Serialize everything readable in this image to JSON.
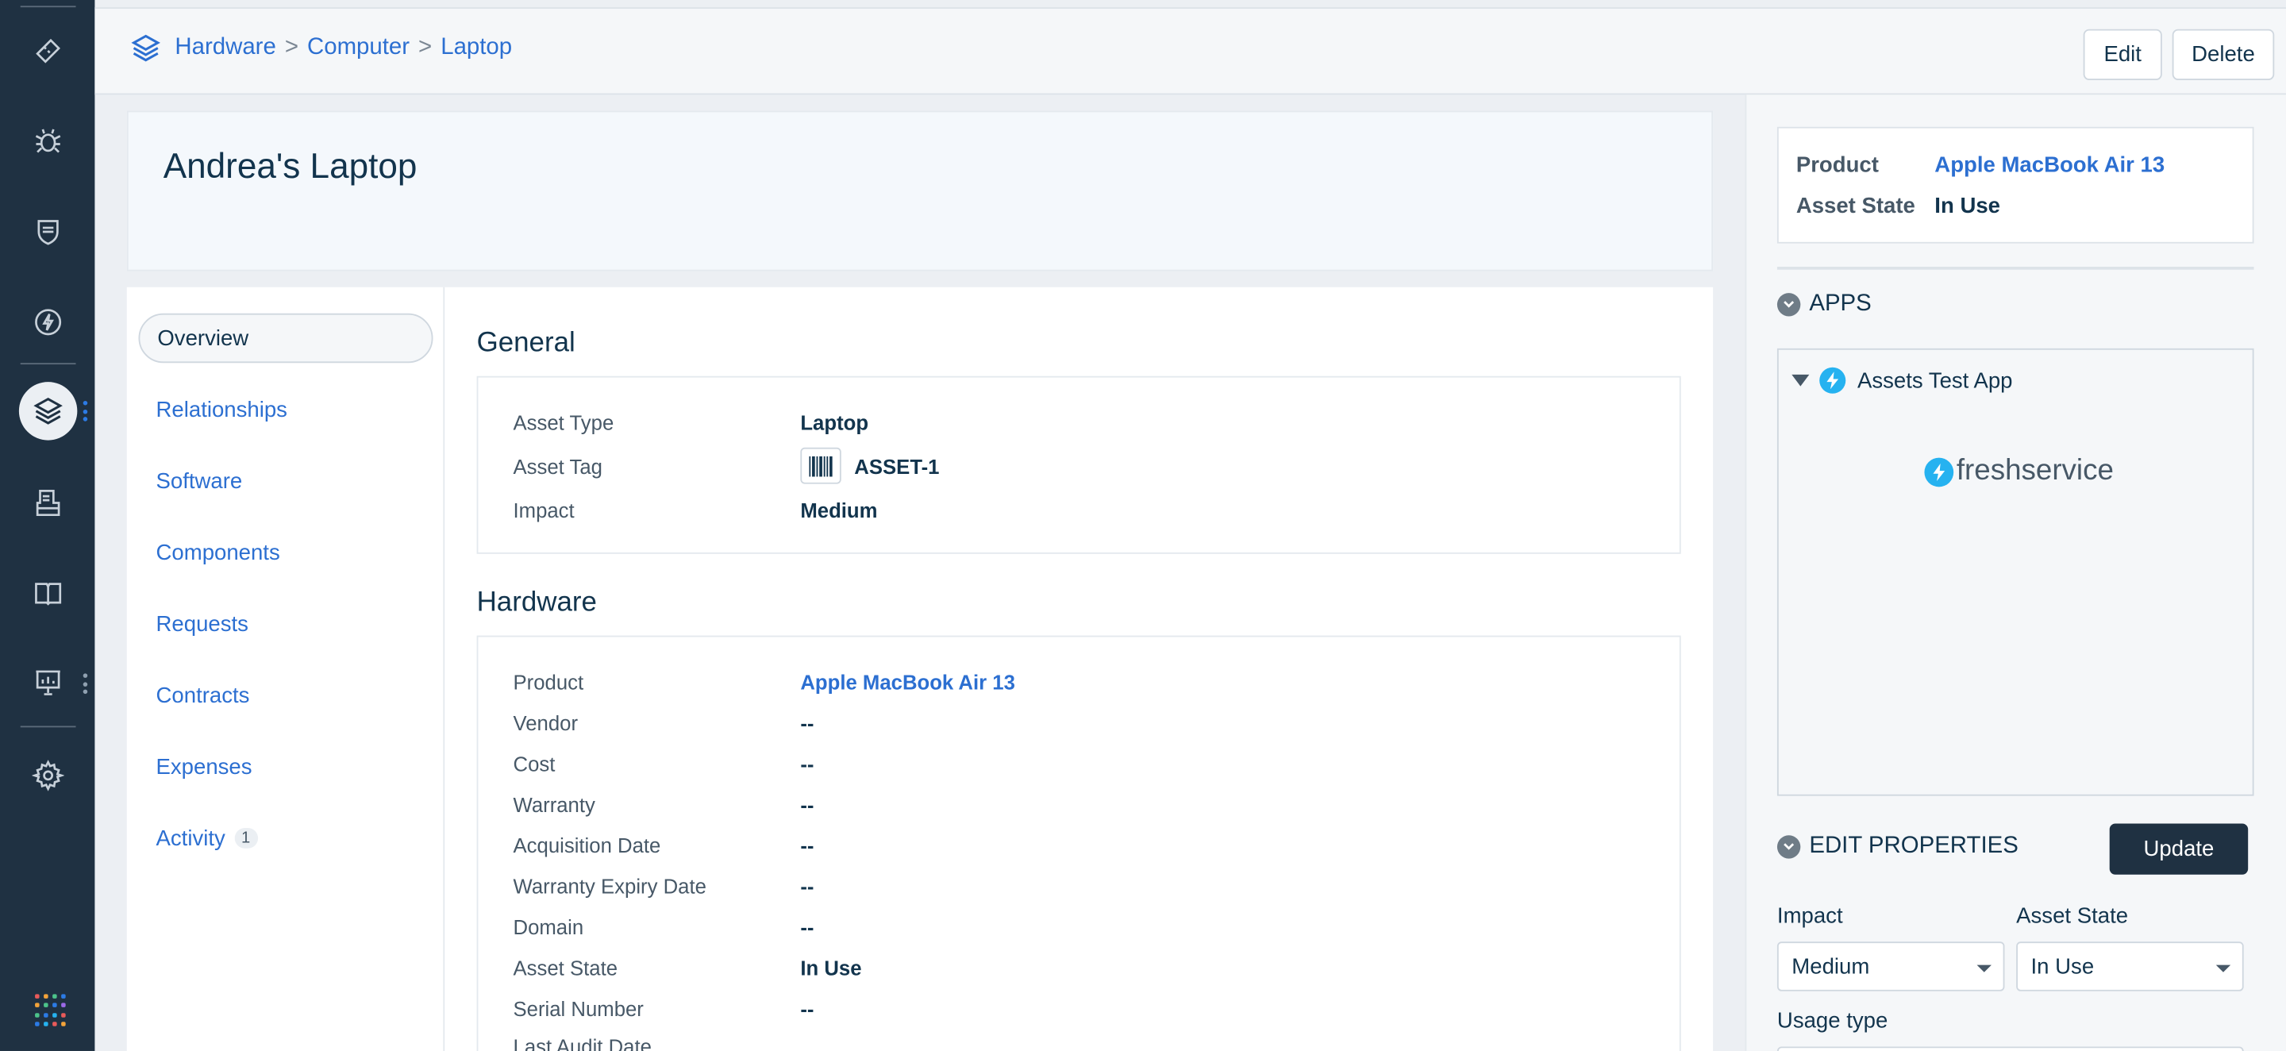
{
  "breadcrumb": {
    "items": [
      "Hardware",
      "Computer",
      "Laptop"
    ],
    "separator": ">"
  },
  "header": {
    "edit_label": "Edit",
    "delete_label": "Delete"
  },
  "asset": {
    "title": "Andrea's Laptop"
  },
  "tabs": [
    {
      "label": "Overview",
      "active": true
    },
    {
      "label": "Relationships"
    },
    {
      "label": "Software"
    },
    {
      "label": "Components"
    },
    {
      "label": "Requests"
    },
    {
      "label": "Contracts"
    },
    {
      "label": "Expenses"
    },
    {
      "label": "Activity",
      "badge": "1"
    }
  ],
  "general": {
    "title": "General",
    "fields": [
      {
        "key": "Asset Type",
        "value": "Laptop"
      },
      {
        "key": "Asset Tag",
        "value": "ASSET-1",
        "icon": "barcode-icon"
      },
      {
        "key": "Impact",
        "value": "Medium"
      }
    ]
  },
  "hardware": {
    "title": "Hardware",
    "fields": [
      {
        "key": "Product",
        "value": "Apple MacBook Air 13",
        "link": true
      },
      {
        "key": "Vendor",
        "value": "--"
      },
      {
        "key": "Cost",
        "value": "--"
      },
      {
        "key": "Warranty",
        "value": "--"
      },
      {
        "key": "Acquisition Date",
        "value": "--"
      },
      {
        "key": "Warranty Expiry Date",
        "value": "--"
      },
      {
        "key": "Domain",
        "value": "--"
      },
      {
        "key": "Asset State",
        "value": "In Use"
      },
      {
        "key": "Serial Number",
        "value": "--"
      },
      {
        "key": "Last Audit Date",
        "value": ""
      }
    ]
  },
  "sidebar": {
    "summary": [
      {
        "key": "Product",
        "value": "Apple MacBook Air 13",
        "link": true
      },
      {
        "key": "Asset State",
        "value": "In Use"
      }
    ],
    "apps_heading": "APPS",
    "app_name": "Assets Test App",
    "app_logo_text": "freshservice",
    "edit_heading": "EDIT PROPERTIES",
    "update_label": "Update",
    "impact_label": "Impact",
    "impact_value": "Medium",
    "state_label": "Asset State",
    "state_value": "In Use",
    "usage_label": "Usage type"
  },
  "colors": {
    "nav_bg": "#1f3142",
    "link": "#2c6fd1",
    "text": "#12344d",
    "accent_app": "#26b2f0"
  },
  "nav_icons": [
    "ticket-icon",
    "bug-icon",
    "shield-icon",
    "bolt-icon",
    "layers-icon",
    "document-icon",
    "book-icon",
    "chart-icon",
    "gear-icon",
    "apps-grid-icon"
  ]
}
